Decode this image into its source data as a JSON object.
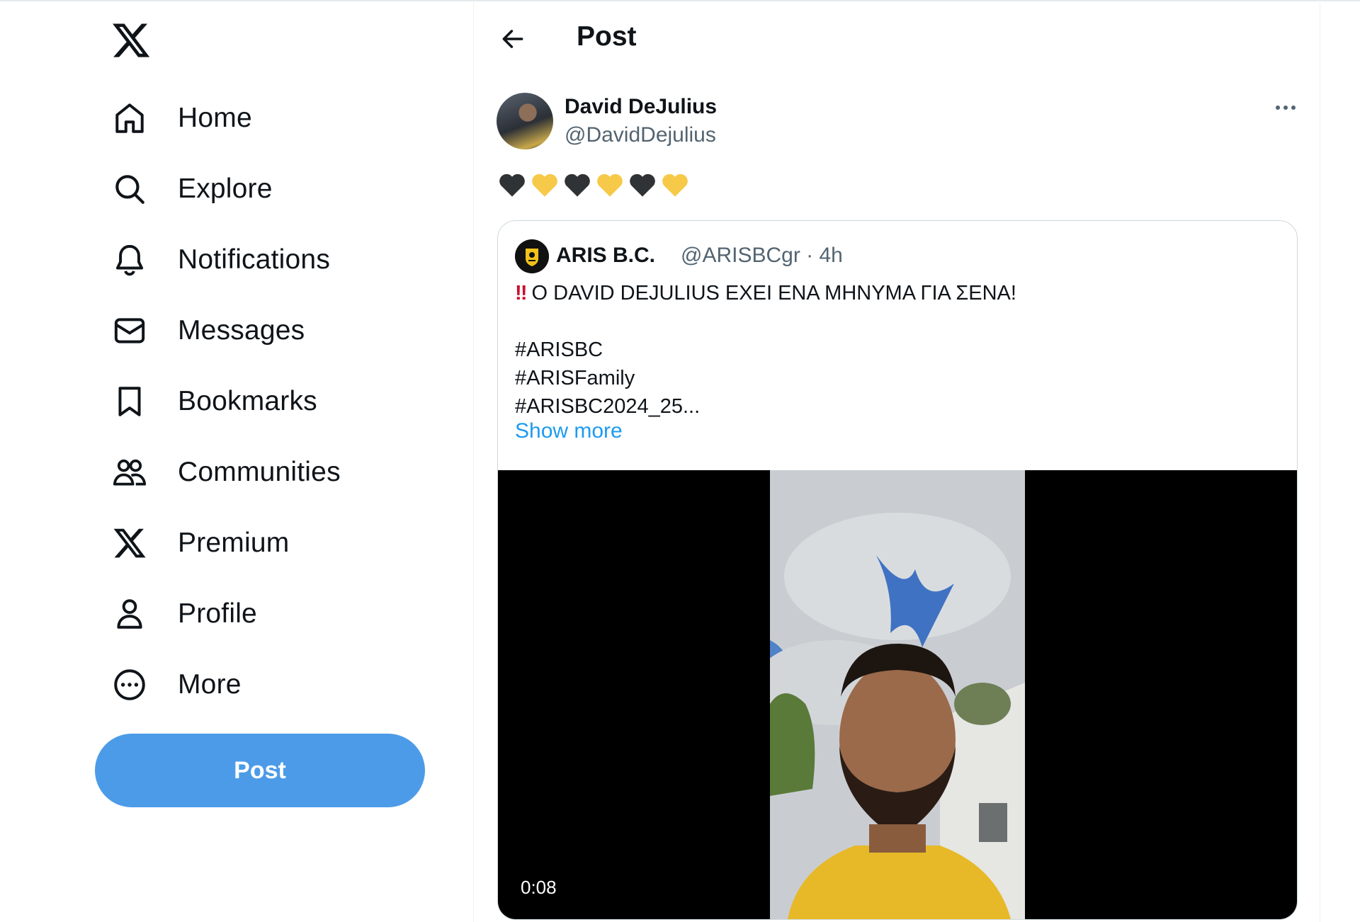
{
  "sidebar": {
    "items": [
      {
        "key": "home",
        "label": "Home",
        "icon": "home-icon"
      },
      {
        "key": "explore",
        "label": "Explore",
        "icon": "search-icon"
      },
      {
        "key": "notifications",
        "label": "Notifications",
        "icon": "bell-icon"
      },
      {
        "key": "messages",
        "label": "Messages",
        "icon": "envelope-icon"
      },
      {
        "key": "bookmarks",
        "label": "Bookmarks",
        "icon": "bookmark-icon"
      },
      {
        "key": "communities",
        "label": "Communities",
        "icon": "people-icon"
      },
      {
        "key": "premium",
        "label": "Premium",
        "icon": "x-logo-icon"
      },
      {
        "key": "profile",
        "label": "Profile",
        "icon": "person-icon"
      },
      {
        "key": "more",
        "label": "More",
        "icon": "more-circle-icon"
      }
    ],
    "post_button": "Post"
  },
  "header": {
    "title": "Post"
  },
  "post": {
    "author_name": "David DeJulius",
    "author_handle": "@DavidDejulius",
    "emojis": [
      "black-heart",
      "yellow-heart",
      "black-heart",
      "yellow-heart",
      "black-heart",
      "yellow-heart"
    ],
    "quoted": {
      "name": "ARIS B.C.",
      "handle_time": "@ARISBCgr · 4h",
      "headline": "Ο DAVID DEJULIUS ΕΧΕΙ ΕΝΑ ΜΗΝΥΜΑ ΓΙΑ ΣΕΝΑ!",
      "emphasis": "‼",
      "hashtags": [
        "#ARISBC",
        "#ARISFamily",
        "#ARISBC2024_25..."
      ],
      "show_more": "Show more",
      "video_duration": "0:08"
    }
  },
  "colors": {
    "accent": "#1d9bf0",
    "post_button": "#4c9be8",
    "text_primary": "#0f1419",
    "text_secondary": "#536471",
    "heart_black": "#2f3336",
    "heart_yellow": "#f7c948"
  }
}
